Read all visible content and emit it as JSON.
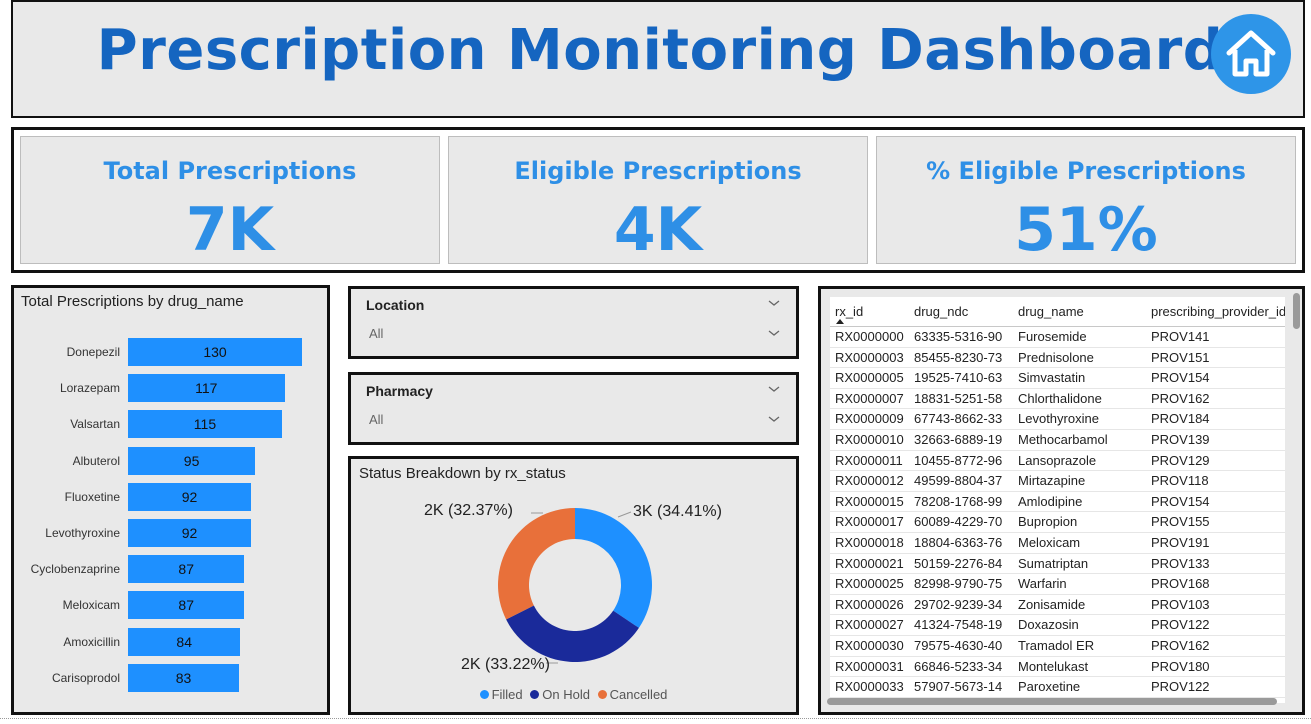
{
  "header": {
    "title": "Prescription Monitoring Dashboard",
    "home_icon": "home-icon"
  },
  "kpis": [
    {
      "label": "Total Prescriptions",
      "value": "7K"
    },
    {
      "label": "Eligible Prescriptions",
      "value": "4K"
    },
    {
      "label": "% Eligible Prescriptions",
      "value": "51%"
    }
  ],
  "colors": {
    "title": "#1565c0",
    "kpi": "#2e8fe6",
    "bar": "#1e90ff",
    "filled": "#1e90ff",
    "on_hold": "#1a2a9a",
    "cancelled": "#e8703a"
  },
  "slicers": [
    {
      "title": "Location",
      "value": "All"
    },
    {
      "title": "Pharmacy",
      "value": "All"
    }
  ],
  "chart_data": [
    {
      "type": "bar",
      "orientation": "horizontal",
      "title": "Total Prescriptions by drug_name",
      "categories": [
        "Donepezil",
        "Lorazepam",
        "Valsartan",
        "Albuterol",
        "Fluoxetine",
        "Levothyroxine",
        "Cyclobenzaprine",
        "Meloxicam",
        "Amoxicillin",
        "Carisoprodol"
      ],
      "values": [
        130,
        117,
        115,
        95,
        92,
        92,
        87,
        87,
        84,
        83
      ],
      "data_labels": true
    },
    {
      "type": "pie",
      "variant": "donut",
      "title": "Status Breakdown by rx_status",
      "slices": [
        {
          "name": "Filled",
          "percent": 34.41,
          "label": "3K (34.41%)"
        },
        {
          "name": "On Hold",
          "percent": 33.22,
          "label": "2K (33.22%)"
        },
        {
          "name": "Cancelled",
          "percent": 32.37,
          "label": "2K (32.37%)"
        }
      ],
      "legend": [
        "Filled",
        "On Hold",
        "Cancelled"
      ],
      "legend_position": "bottom"
    }
  ],
  "table": {
    "columns": [
      "rx_id",
      "drug_ndc",
      "drug_name",
      "prescribing_provider_id"
    ],
    "sorted_column": "rx_id",
    "rows": [
      [
        "RX0000000",
        "63335-5316-90",
        "Furosemide",
        "PROV141"
      ],
      [
        "RX0000003",
        "85455-8230-73",
        "Prednisolone",
        "PROV151"
      ],
      [
        "RX0000005",
        "19525-7410-63",
        "Simvastatin",
        "PROV154"
      ],
      [
        "RX0000007",
        "18831-5251-58",
        "Chlorthalidone",
        "PROV162"
      ],
      [
        "RX0000009",
        "67743-8662-33",
        "Levothyroxine",
        "PROV184"
      ],
      [
        "RX0000010",
        "32663-6889-19",
        "Methocarbamol",
        "PROV139"
      ],
      [
        "RX0000011",
        "10455-8772-96",
        "Lansoprazole",
        "PROV129"
      ],
      [
        "RX0000012",
        "49599-8804-37",
        "Mirtazapine",
        "PROV118"
      ],
      [
        "RX0000015",
        "78208-1768-99",
        "Amlodipine",
        "PROV154"
      ],
      [
        "RX0000017",
        "60089-4229-70",
        "Bupropion",
        "PROV155"
      ],
      [
        "RX0000018",
        "18804-6363-76",
        "Meloxicam",
        "PROV191"
      ],
      [
        "RX0000021",
        "50159-2276-84",
        "Sumatriptan",
        "PROV133"
      ],
      [
        "RX0000025",
        "82998-9790-75",
        "Warfarin",
        "PROV168"
      ],
      [
        "RX0000026",
        "29702-9239-34",
        "Zonisamide",
        "PROV103"
      ],
      [
        "RX0000027",
        "41324-7548-19",
        "Doxazosin",
        "PROV122"
      ],
      [
        "RX0000030",
        "79575-4630-40",
        "Tramadol ER",
        "PROV162"
      ],
      [
        "RX0000031",
        "66846-5233-34",
        "Montelukast",
        "PROV180"
      ],
      [
        "RX0000033",
        "57907-5673-14",
        "Paroxetine",
        "PROV122"
      ]
    ]
  }
}
